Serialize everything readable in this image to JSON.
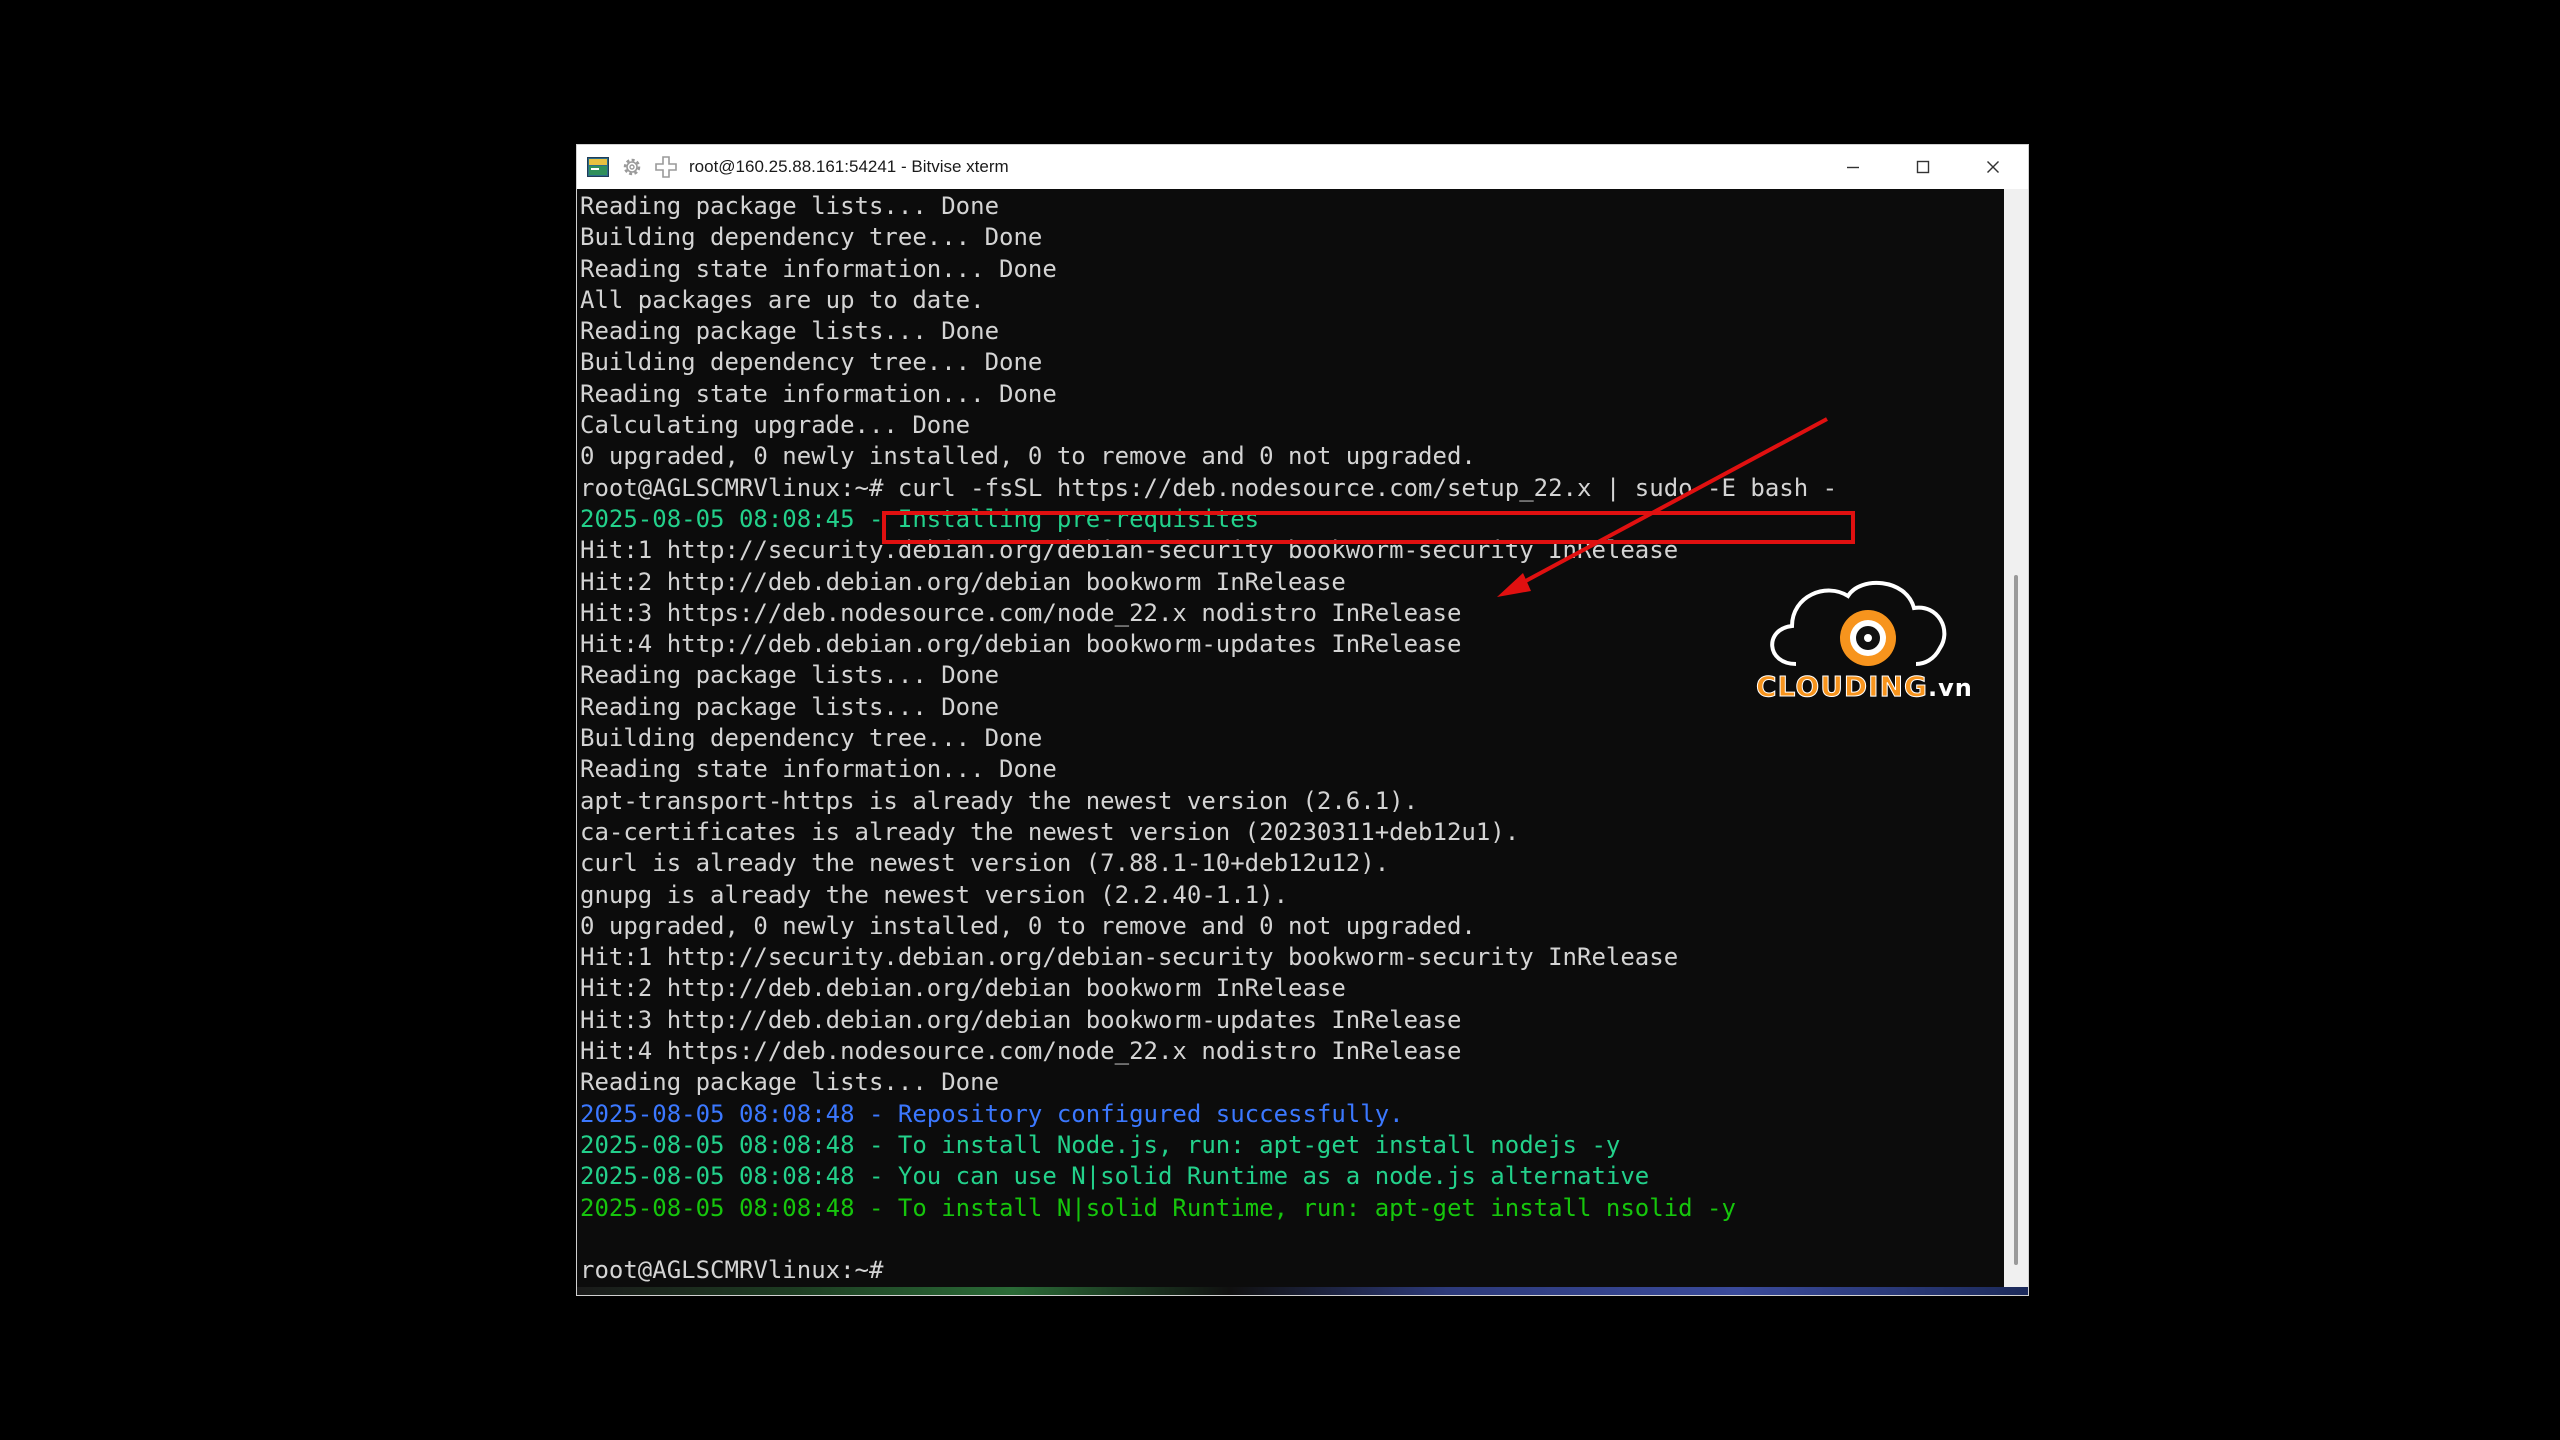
{
  "window": {
    "title": "root@160.25.88.161:54241 - Bitvise xterm",
    "icons": {
      "app": "bitvise-terminal-icon",
      "settings": "gear-icon",
      "move": "move-cross-icon",
      "minimize": "minimize-icon",
      "maximize": "maximize-icon",
      "close": "close-icon"
    }
  },
  "terminal": {
    "lines": [
      {
        "text": "Reading package lists... Done",
        "color": "#d4d4d4"
      },
      {
        "text": "Building dependency tree... Done",
        "color": "#d4d4d4"
      },
      {
        "text": "Reading state information... Done",
        "color": "#d4d4d4"
      },
      {
        "text": "All packages are up to date.",
        "color": "#d4d4d4"
      },
      {
        "text": "Reading package lists... Done",
        "color": "#d4d4d4"
      },
      {
        "text": "Building dependency tree... Done",
        "color": "#d4d4d4"
      },
      {
        "text": "Reading state information... Done",
        "color": "#d4d4d4"
      },
      {
        "text": "Calculating upgrade... Done",
        "color": "#d4d4d4"
      },
      {
        "text": "0 upgraded, 0 newly installed, 0 to remove and 0 not upgraded.",
        "color": "#d4d4d4"
      },
      {
        "text": "root@AGLSCMRVlinux:~# curl -fsSL https://deb.nodesource.com/setup_22.x | sudo -E bash -",
        "color": "#d4d4d4"
      },
      {
        "text": "2025-08-05 08:08:45 - Installing pre-requisites",
        "color": "#23d18b"
      },
      {
        "text": "Hit:1 http://security.debian.org/debian-security bookworm-security InRelease",
        "color": "#d4d4d4"
      },
      {
        "text": "Hit:2 http://deb.debian.org/debian bookworm InRelease",
        "color": "#d4d4d4"
      },
      {
        "text": "Hit:3 https://deb.nodesource.com/node_22.x nodistro InRelease",
        "color": "#d4d4d4"
      },
      {
        "text": "Hit:4 http://deb.debian.org/debian bookworm-updates InRelease",
        "color": "#d4d4d4"
      },
      {
        "text": "Reading package lists... Done",
        "color": "#d4d4d4"
      },
      {
        "text": "Reading package lists... Done",
        "color": "#d4d4d4"
      },
      {
        "text": "Building dependency tree... Done",
        "color": "#d4d4d4"
      },
      {
        "text": "Reading state information... Done",
        "color": "#d4d4d4"
      },
      {
        "text": "apt-transport-https is already the newest version (2.6.1).",
        "color": "#d4d4d4"
      },
      {
        "text": "ca-certificates is already the newest version (20230311+deb12u1).",
        "color": "#d4d4d4"
      },
      {
        "text": "curl is already the newest version (7.88.1-10+deb12u12).",
        "color": "#d4d4d4"
      },
      {
        "text": "gnupg is already the newest version (2.2.40-1.1).",
        "color": "#d4d4d4"
      },
      {
        "text": "0 upgraded, 0 newly installed, 0 to remove and 0 not upgraded.",
        "color": "#d4d4d4"
      },
      {
        "text": "Hit:1 http://security.debian.org/debian-security bookworm-security InRelease",
        "color": "#d4d4d4"
      },
      {
        "text": "Hit:2 http://deb.debian.org/debian bookworm InRelease",
        "color": "#d4d4d4"
      },
      {
        "text": "Hit:3 http://deb.debian.org/debian bookworm-updates InRelease",
        "color": "#d4d4d4"
      },
      {
        "text": "Hit:4 https://deb.nodesource.com/node_22.x nodistro InRelease",
        "color": "#d4d4d4"
      },
      {
        "text": "Reading package lists... Done",
        "color": "#d4d4d4"
      },
      {
        "text": "2025-08-05 08:08:48 - Repository configured successfully.",
        "color": "#3b78ff"
      },
      {
        "text": "2025-08-05 08:08:48 - To install Node.js, run: apt-get install nodejs -y",
        "color": "#23d18b"
      },
      {
        "text": "2025-08-05 08:08:48 - You can use N|solid Runtime as a node.js alternative",
        "color": "#23d18b"
      },
      {
        "text": "2025-08-05 08:08:48 - To install N|solid Runtime, run: apt-get install nsolid -y",
        "color": "#16c60c"
      },
      {
        "text": "",
        "color": "#d4d4d4"
      },
      {
        "text": "root@AGLSCMRVlinux:~#",
        "color": "#d4d4d4"
      }
    ]
  },
  "annotation": {
    "highlight_color": "#e01010"
  },
  "watermark": {
    "brand": "CLOUDING",
    "suffix": ".vn",
    "color": "#f7941d"
  }
}
